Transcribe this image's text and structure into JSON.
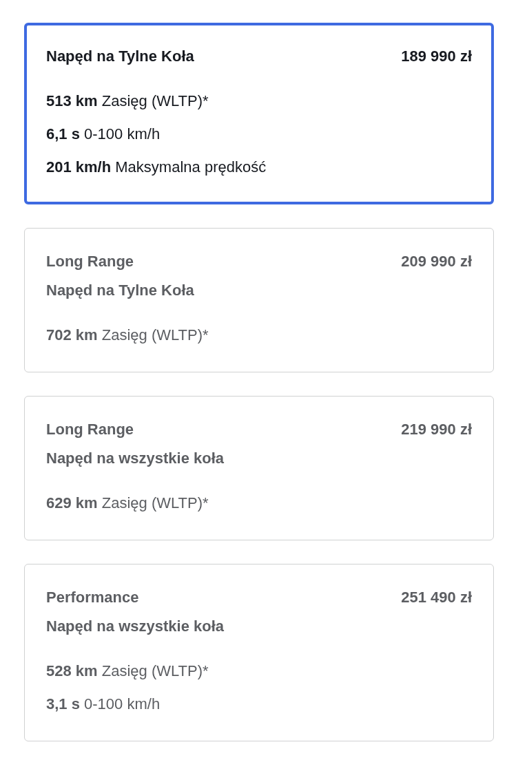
{
  "options": [
    {
      "selected": true,
      "title_lines": [
        "Napęd na Tylne Koła"
      ],
      "price": "189 990 zł",
      "specs": [
        {
          "value": "513 km",
          "label": "Zasięg (WLTP)*"
        },
        {
          "value": "6,1 s",
          "label": "0-100 km/h"
        },
        {
          "value": "201 km/h",
          "label": "Maksymalna prędkość"
        }
      ]
    },
    {
      "selected": false,
      "title_lines": [
        "Long Range",
        "Napęd na Tylne Koła"
      ],
      "price": "209 990 zł",
      "specs": [
        {
          "value": "702 km",
          "label": "Zasięg (WLTP)*"
        }
      ]
    },
    {
      "selected": false,
      "title_lines": [
        "Long Range",
        "Napęd na wszystkie koła"
      ],
      "price": "219 990 zł",
      "specs": [
        {
          "value": "629 km",
          "label": "Zasięg (WLTP)*"
        }
      ]
    },
    {
      "selected": false,
      "title_lines": [
        "Performance",
        "Napęd na wszystkie koła"
      ],
      "price": "251 490 zł",
      "specs": [
        {
          "value": "528 km",
          "label": "Zasięg (WLTP)*"
        },
        {
          "value": "3,1 s",
          "label": "0-100 km/h"
        }
      ]
    }
  ]
}
